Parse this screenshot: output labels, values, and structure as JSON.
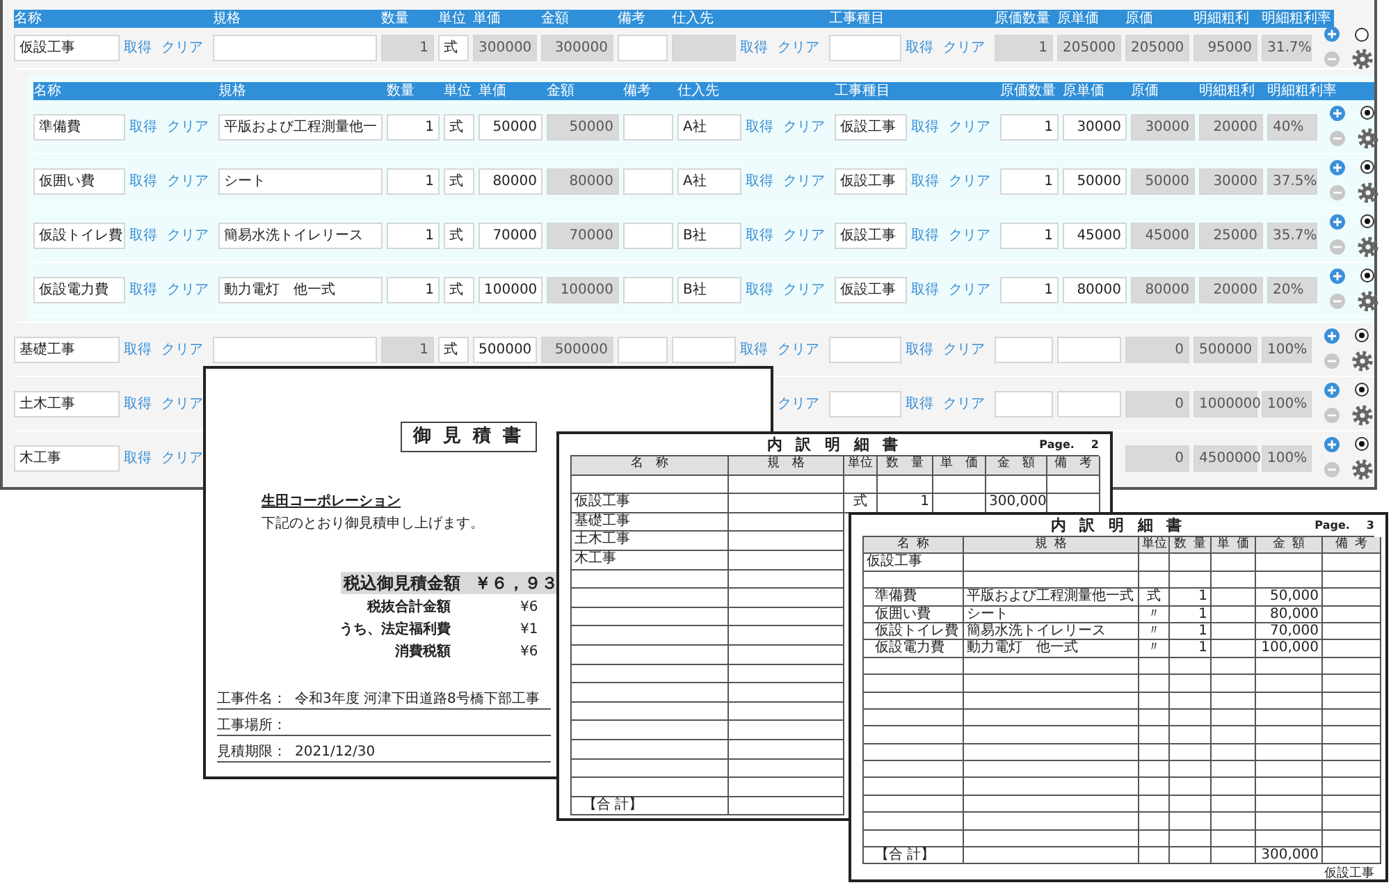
{
  "columns": {
    "name": "名称",
    "spec": "規格",
    "quantity": "数量",
    "unit": "単位",
    "unit_price": "単価",
    "amount": "金額",
    "remarks": "備考",
    "supplier": "仕入先",
    "work_type": "工事種目",
    "cost_quantity": "原価数量",
    "cost_unit_price": "原単価",
    "cost": "原価",
    "profit": "明細粗利",
    "profit_rate": "明細粗利率"
  },
  "rows": [
    {
      "name": {
        "value": "仮設工事",
        "readonly": false
      },
      "name_get": "取得",
      "name_clear": "クリア",
      "spec": {
        "readonly": false
      },
      "quantity": {
        "value": "1",
        "readonly": true
      },
      "unit": {
        "value": "式",
        "readonly": false
      },
      "unit_price": {
        "value": "300000",
        "readonly": true
      },
      "amount": {
        "value": "300000",
        "readonly": true
      },
      "remarks": {
        "readonly": false
      },
      "supplier": {
        "readonly": true
      },
      "supplier_get": "取得",
      "supplier_clear": "クリア",
      "work_type": {
        "readonly": false
      },
      "work_type_get": "取得",
      "work_type_clear": "クリア",
      "cost_quantity": {
        "value": "1",
        "readonly": true
      },
      "cost_unit_price": {
        "value": "205000",
        "readonly": true
      },
      "cost": {
        "value": "205000",
        "readonly": true
      },
      "profit": {
        "value": "95000",
        "readonly": true
      },
      "profit_rate": {
        "value": "31.7%",
        "readonly": true
      },
      "selected": false,
      "detail_columns": {
        "name": "名称",
        "spec": "規格",
        "quantity": "数量",
        "unit": "単位",
        "unit_price": "単価",
        "amount": "金額",
        "remarks": "備考",
        "supplier": "仕入先",
        "work_type": "工事種目",
        "cost_quantity": "原価数量",
        "cost_unit_price": "原単価",
        "cost": "原価",
        "profit": "明細粗利",
        "profit_rate": "明細粗利率"
      },
      "children": [
        {
          "name": {
            "value": "準備費",
            "readonly": false
          },
          "name_get": "取得",
          "name_clear": "クリア",
          "spec": {
            "value": "平版および工程測量他一",
            "readonly": false
          },
          "quantity": {
            "value": "1",
            "readonly": false
          },
          "unit": {
            "value": "式",
            "readonly": false
          },
          "unit_price": {
            "value": "50000",
            "readonly": false
          },
          "amount": {
            "value": "50000",
            "readonly": true
          },
          "remarks": {
            "readonly": false
          },
          "supplier": {
            "value": "A社",
            "readonly": false
          },
          "supplier_get": "取得",
          "supplier_clear": "クリア",
          "work_type": {
            "value": "仮設工事",
            "readonly": false
          },
          "work_type_get": "取得",
          "work_type_clear": "クリア",
          "cost_quantity": {
            "value": "1",
            "readonly": false
          },
          "cost_unit_price": {
            "value": "30000",
            "readonly": false
          },
          "cost": {
            "value": "30000",
            "readonly": true
          },
          "profit": {
            "value": "20000",
            "readonly": true
          },
          "profit_rate": {
            "value": "40%",
            "readonly": true
          },
          "selected": true
        },
        {
          "name": {
            "value": "仮囲い費",
            "readonly": false
          },
          "name_get": "取得",
          "name_clear": "クリア",
          "spec": {
            "value": "シート",
            "readonly": false
          },
          "quantity": {
            "value": "1",
            "readonly": false
          },
          "unit": {
            "value": "式",
            "readonly": false
          },
          "unit_price": {
            "value": "80000",
            "readonly": false
          },
          "amount": {
            "value": "80000",
            "readonly": true
          },
          "remarks": {
            "readonly": false
          },
          "supplier": {
            "value": "A社",
            "readonly": false
          },
          "supplier_get": "取得",
          "supplier_clear": "クリア",
          "work_type": {
            "value": "仮設工事",
            "readonly": false
          },
          "work_type_get": "取得",
          "work_type_clear": "クリア",
          "cost_quantity": {
            "value": "1",
            "readonly": false
          },
          "cost_unit_price": {
            "value": "50000",
            "readonly": false
          },
          "cost": {
            "value": "50000",
            "readonly": true
          },
          "profit": {
            "value": "30000",
            "readonly": true
          },
          "profit_rate": {
            "value": "37.5%",
            "readonly": true
          },
          "selected": true
        },
        {
          "name": {
            "value": "仮設トイレ費",
            "readonly": false
          },
          "name_get": "取得",
          "name_clear": "クリア",
          "spec": {
            "value": "簡易水洗トイレリース",
            "readonly": false
          },
          "quantity": {
            "value": "1",
            "readonly": false
          },
          "unit": {
            "value": "式",
            "readonly": false
          },
          "unit_price": {
            "value": "70000",
            "readonly": false
          },
          "amount": {
            "value": "70000",
            "readonly": true
          },
          "remarks": {
            "readonly": false
          },
          "supplier": {
            "value": "B社",
            "readonly": false
          },
          "supplier_get": "取得",
          "supplier_clear": "クリア",
          "work_type": {
            "value": "仮設工事",
            "readonly": false
          },
          "work_type_get": "取得",
          "work_type_clear": "クリア",
          "cost_quantity": {
            "value": "1",
            "readonly": false
          },
          "cost_unit_price": {
            "value": "45000",
            "readonly": false
          },
          "cost": {
            "value": "45000",
            "readonly": true
          },
          "profit": {
            "value": "25000",
            "readonly": true
          },
          "profit_rate": {
            "value": "35.7%",
            "readonly": true
          },
          "selected": true
        },
        {
          "name": {
            "value": "仮設電力費",
            "readonly": false
          },
          "name_get": "取得",
          "name_clear": "クリア",
          "spec": {
            "value": "動力電灯　他一式",
            "readonly": false
          },
          "quantity": {
            "value": "1",
            "readonly": false
          },
          "unit": {
            "value": "式",
            "readonly": false
          },
          "unit_price": {
            "value": "100000",
            "readonly": false
          },
          "amount": {
            "value": "100000",
            "readonly": true
          },
          "remarks": {
            "readonly": false
          },
          "supplier": {
            "value": "B社",
            "readonly": false
          },
          "supplier_get": "取得",
          "supplier_clear": "クリア",
          "work_type": {
            "value": "仮設工事",
            "readonly": false
          },
          "work_type_get": "取得",
          "work_type_clear": "クリア",
          "cost_quantity": {
            "value": "1",
            "readonly": false
          },
          "cost_unit_price": {
            "value": "80000",
            "readonly": false
          },
          "cost": {
            "value": "80000",
            "readonly": true
          },
          "profit": {
            "value": "20000",
            "readonly": true
          },
          "profit_rate": {
            "value": "20%",
            "readonly": true
          },
          "selected": true
        }
      ]
    },
    {
      "name": {
        "value": "基礎工事",
        "readonly": false
      },
      "name_get": "取得",
      "name_clear": "クリア",
      "spec": {
        "readonly": false
      },
      "quantity": {
        "value": "1",
        "readonly": true
      },
      "unit": {
        "value": "式",
        "readonly": false
      },
      "unit_price": {
        "value": "500000",
        "readonly": false
      },
      "amount": {
        "value": "500000",
        "readonly": true
      },
      "remarks": {
        "readonly": false
      },
      "supplier": {
        "readonly": false
      },
      "supplier_get": "取得",
      "supplier_clear": "クリア",
      "work_type": {
        "readonly": false
      },
      "work_type_get": "取得",
      "work_type_clear": "クリア",
      "cost_quantity": {
        "readonly": false
      },
      "cost_unit_price": {
        "readonly": false
      },
      "cost": {
        "value": "0",
        "readonly": true
      },
      "profit": {
        "value": "500000",
        "readonly": true
      },
      "profit_rate": {
        "value": "100%",
        "readonly": true
      },
      "selected": true
    },
    {
      "name": {
        "value": "土木工事",
        "readonly": false
      },
      "name_get": "取得",
      "name_clear": "クリア",
      "supplier_clear": "クリア",
      "work_type": {
        "readonly": false
      },
      "work_type_get": "取得",
      "work_type_clear": "クリア",
      "cost_quantity": {
        "readonly": false
      },
      "cost_unit_price": {
        "readonly": false
      },
      "cost": {
        "value": "0",
        "readonly": true
      },
      "profit": {
        "value": "1000000",
        "readonly": true
      },
      "profit_rate": {
        "value": "100%",
        "readonly": true
      },
      "selected": true
    },
    {
      "name": {
        "value": "木工事",
        "readonly": false
      },
      "name_get": "取得",
      "name_clear": "クリア",
      "cost": {
        "value": "0",
        "readonly": true
      },
      "profit": {
        "value": "4500000",
        "readonly": true
      },
      "profit_rate": {
        "value": "100%",
        "readonly": true
      },
      "selected": true
    }
  ],
  "quotation": {
    "title": "御 見 積 書",
    "client": "生田コーポレーション",
    "greeting": "下記のとおり御見積申し上げます。",
    "total_label": "税込御見積金額",
    "total_value": "￥６，９３",
    "summary": [
      {
        "label": "税抜合計金額",
        "value": "¥6"
      },
      {
        "label": "うち、法定福利費",
        "value": "¥1"
      },
      {
        "label": "消費税額",
        "value": "¥6"
      }
    ],
    "fields": [
      {
        "label": "工事件名：",
        "value": "令和3年度 河津下田道路8号橋下部工事"
      },
      {
        "label": "工事場所："
      },
      {
        "label": "見積期限：",
        "value": "2021/12/30"
      }
    ]
  },
  "statements": [
    {
      "title": "内 訳 明 細 書",
      "page_label": "Page.",
      "page": "2",
      "columns": [
        "名 称",
        "規 格",
        "単位",
        "数 量",
        "単 価",
        "金 額",
        "備 考"
      ],
      "rows": [
        {
          "kind": "blank"
        },
        {
          "kind": "group",
          "name": "仮設工事",
          "unit": "式",
          "quantity": "1",
          "amount": "300,000"
        },
        {
          "kind": "group",
          "name": "基礎工事"
        },
        {
          "kind": "group",
          "name": "土木工事"
        },
        {
          "kind": "group",
          "name": "木工事"
        }
      ],
      "total": {
        "label": "【合 計】"
      }
    },
    {
      "title": "内 訳 明 細 書",
      "page_label": "Page.",
      "page": "3",
      "columns": [
        "名 称",
        "規 格",
        "単位",
        "数 量",
        "単 価",
        "金 額",
        "備 考"
      ],
      "rows": [
        {
          "kind": "group",
          "name": "仮設工事"
        },
        {
          "kind": "blank"
        },
        {
          "kind": "item",
          "name": "準備費",
          "spec": "平版および工程測量他一式",
          "unit": "式",
          "quantity": "1",
          "amount": "50,000"
        },
        {
          "kind": "item",
          "name": "仮囲い費",
          "spec": "シート",
          "unit": "〃",
          "quantity": "1",
          "amount": "80,000"
        },
        {
          "kind": "item",
          "name": "仮設トイレ費",
          "spec": "簡易水洗トイレリース",
          "unit": "〃",
          "quantity": "1",
          "amount": "70,000"
        },
        {
          "kind": "item",
          "name": "仮設電力費",
          "spec": "動力電灯　他一式",
          "unit": "〃",
          "quantity": "1",
          "amount": "100,000"
        }
      ],
      "total": {
        "label": "【合 計】",
        "amount": "300,000"
      },
      "footer": "仮設工事"
    }
  ]
}
